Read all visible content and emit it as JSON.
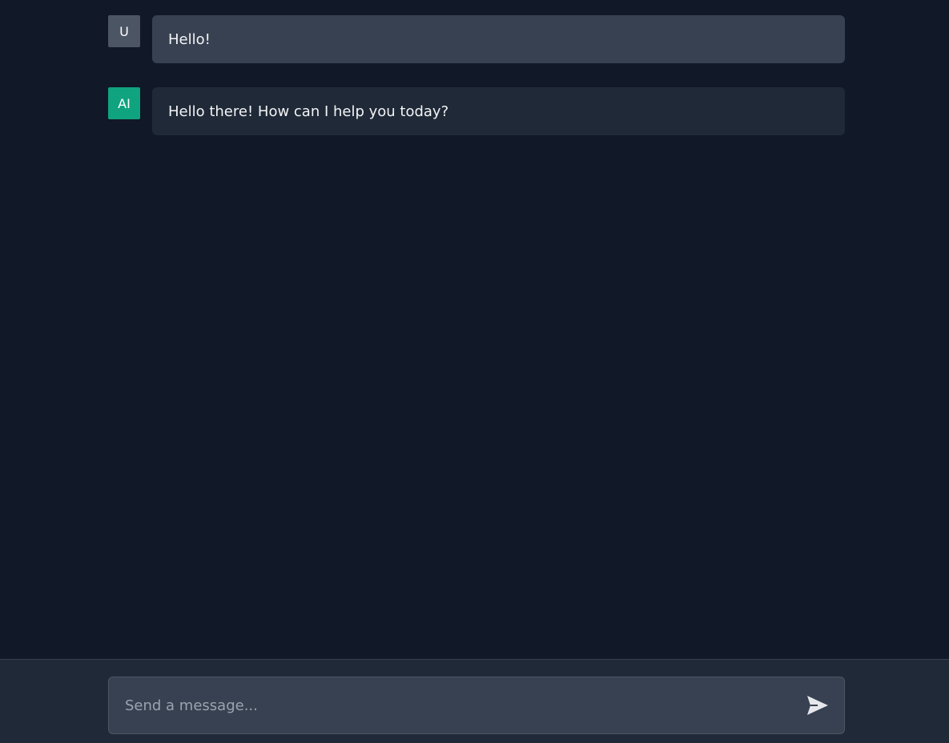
{
  "messages": [
    {
      "role": "user",
      "avatar": "U",
      "text": "Hello!"
    },
    {
      "role": "assistant",
      "avatar": "AI",
      "text": "Hello there! How can I help you today?"
    }
  ],
  "composer": {
    "placeholder": "Send a message...",
    "value": "",
    "send_icon": "send-icon"
  },
  "colors": {
    "background": "#111827",
    "user_bubble": "#374151",
    "ai_bubble": "#1f2937",
    "user_avatar": "#4b5563",
    "ai_avatar": "#10a37f"
  }
}
